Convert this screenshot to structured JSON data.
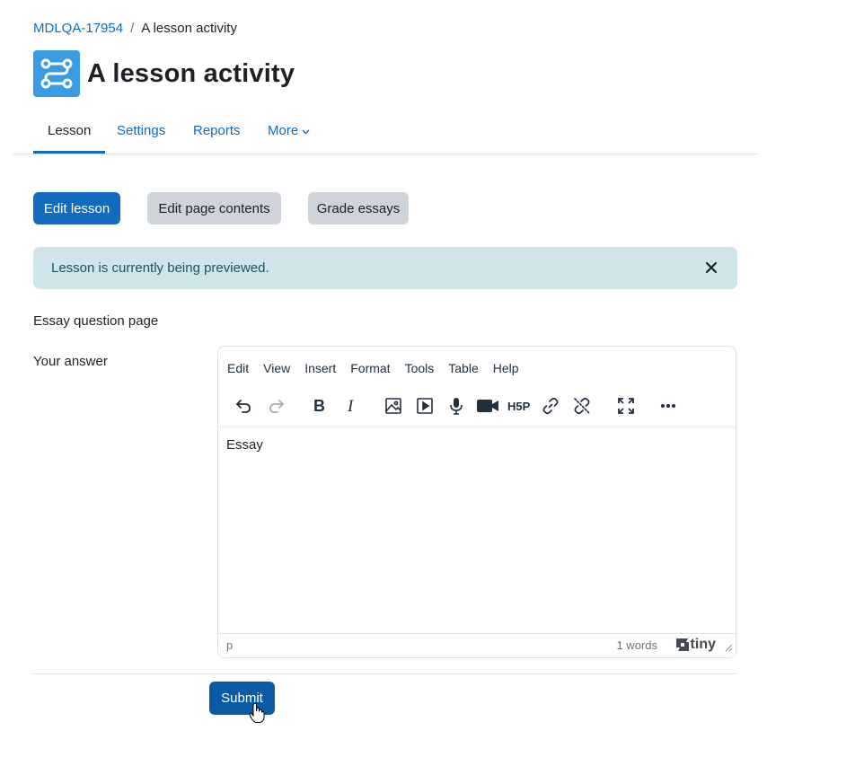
{
  "breadcrumb": {
    "course": "MDLQA-17954",
    "separator": "/",
    "current": "A lesson activity"
  },
  "page": {
    "title": "A lesson activity"
  },
  "tabs": [
    {
      "label": "Lesson",
      "active": true
    },
    {
      "label": "Settings"
    },
    {
      "label": "Reports"
    },
    {
      "label": "More"
    }
  ],
  "actions": {
    "edit_lesson": "Edit lesson",
    "edit_page_contents": "Edit page contents",
    "grade_essays": "Grade essays"
  },
  "alert": {
    "message": "Lesson is currently being previewed."
  },
  "question": {
    "page_title": "Essay question page",
    "answer_label": "Your answer"
  },
  "editor": {
    "menu": [
      "Edit",
      "View",
      "Insert",
      "Format",
      "Tools",
      "Table",
      "Help"
    ],
    "toolbar_icons": [
      "undo-icon",
      "redo-icon",
      "bold-icon",
      "italic-icon",
      "image-icon",
      "media-icon",
      "record-audio-icon",
      "record-video-icon",
      "h5p-icon",
      "link-icon",
      "unlink-icon",
      "fullscreen-icon",
      "more-icon"
    ],
    "content": "Essay",
    "status_path": "p",
    "word_count": "1 words",
    "brand": "tiny"
  },
  "submit": {
    "label": "Submit"
  },
  "colors": {
    "primary": "#0f6cbf",
    "alert_bg": "#cfe5e9",
    "secondary_btn": "#ced4da",
    "activity_icon": "#399be2"
  }
}
